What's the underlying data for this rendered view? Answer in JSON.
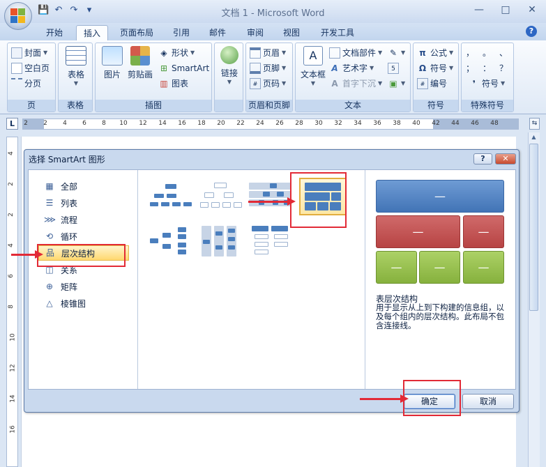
{
  "window": {
    "title": "文档 1 - Microsoft Word",
    "controls": [
      "—",
      "□",
      "✕"
    ]
  },
  "qat": {
    "save": "💾",
    "undo": "↶",
    "redo": "↷",
    "more": "▾"
  },
  "tabs": [
    "开始",
    "插入",
    "页面布局",
    "引用",
    "邮件",
    "审阅",
    "视图",
    "开发工具"
  ],
  "active_tab": "插入",
  "ribbon": {
    "pages": {
      "label": "页",
      "items": [
        "封面",
        "空白页",
        "分页"
      ]
    },
    "table": {
      "label": "表格",
      "button": "表格"
    },
    "illustrations": {
      "label": "插图",
      "picture": "图片",
      "clipart": "剪贴画",
      "shapes": "形状",
      "smartart": "SmartArt",
      "chart": "图表"
    },
    "links": {
      "label": "",
      "button": "链接"
    },
    "header_footer": {
      "label": "页眉和页脚",
      "items": [
        "页眉",
        "页脚",
        "页码"
      ]
    },
    "text": {
      "label": "文本",
      "textbox": "文本框",
      "items": [
        "文档部件",
        "艺术字",
        "首字下沉"
      ]
    },
    "symbols": {
      "label": "符号",
      "items": [
        "公式",
        "符号",
        "编号"
      ]
    },
    "special": {
      "label": "特殊符号",
      "glyphs": [
        "，",
        "。",
        "、",
        "；",
        "：",
        "？"
      ],
      "button": "符号"
    }
  },
  "ruler": {
    "h_numbers": [
      "2",
      "2",
      "4",
      "6",
      "8",
      "10",
      "12",
      "14",
      "16",
      "18",
      "20",
      "22",
      "24",
      "26",
      "28",
      "30",
      "32",
      "34",
      "36",
      "38",
      "40",
      "42",
      "44",
      "46",
      "48"
    ],
    "v_numbers": [
      "4",
      "2",
      "2",
      "4",
      "6",
      "8",
      "10",
      "12",
      "14",
      "16"
    ]
  },
  "dialog": {
    "title": "选择 SmartArt 图形",
    "help": "?",
    "close": "✕",
    "categories": [
      "全部",
      "列表",
      "流程",
      "循环",
      "层次结构",
      "关系",
      "矩阵",
      "棱锥图"
    ],
    "selected_category": "层次结构",
    "preview": {
      "name": "表层次结构",
      "description": "用于显示从上到下构建的信息组，以及每个组内的层次结构。此布局不包含连接线。",
      "placeholder": "—"
    },
    "ok": "确定",
    "cancel": "取消"
  },
  "colors": {
    "accent_red": "#e22a36",
    "selection": "#ffd86f",
    "blue": "#4a7ebd",
    "red": "#b74343",
    "green": "#86b13d"
  }
}
